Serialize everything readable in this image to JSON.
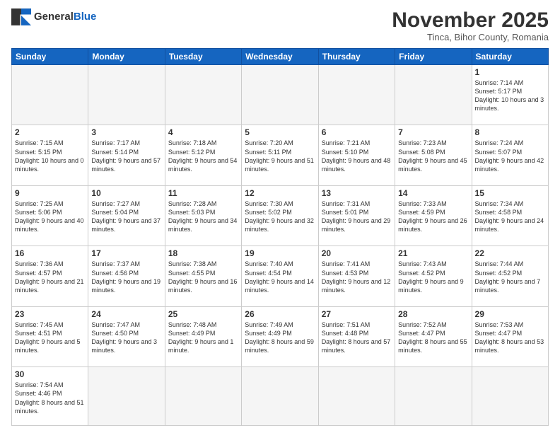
{
  "logo": {
    "general": "General",
    "blue": "Blue"
  },
  "header": {
    "month_title": "November 2025",
    "subtitle": "Tinca, Bihor County, Romania"
  },
  "weekdays": [
    "Sunday",
    "Monday",
    "Tuesday",
    "Wednesday",
    "Thursday",
    "Friday",
    "Saturday"
  ],
  "weeks": [
    [
      {
        "day": "",
        "info": ""
      },
      {
        "day": "",
        "info": ""
      },
      {
        "day": "",
        "info": ""
      },
      {
        "day": "",
        "info": ""
      },
      {
        "day": "",
        "info": ""
      },
      {
        "day": "",
        "info": ""
      },
      {
        "day": "1",
        "info": "Sunrise: 7:14 AM\nSunset: 5:17 PM\nDaylight: 10 hours and 3 minutes."
      }
    ],
    [
      {
        "day": "2",
        "info": "Sunrise: 7:15 AM\nSunset: 5:15 PM\nDaylight: 10 hours and 0 minutes."
      },
      {
        "day": "3",
        "info": "Sunrise: 7:17 AM\nSunset: 5:14 PM\nDaylight: 9 hours and 57 minutes."
      },
      {
        "day": "4",
        "info": "Sunrise: 7:18 AM\nSunset: 5:12 PM\nDaylight: 9 hours and 54 minutes."
      },
      {
        "day": "5",
        "info": "Sunrise: 7:20 AM\nSunset: 5:11 PM\nDaylight: 9 hours and 51 minutes."
      },
      {
        "day": "6",
        "info": "Sunrise: 7:21 AM\nSunset: 5:10 PM\nDaylight: 9 hours and 48 minutes."
      },
      {
        "day": "7",
        "info": "Sunrise: 7:23 AM\nSunset: 5:08 PM\nDaylight: 9 hours and 45 minutes."
      },
      {
        "day": "8",
        "info": "Sunrise: 7:24 AM\nSunset: 5:07 PM\nDaylight: 9 hours and 42 minutes."
      }
    ],
    [
      {
        "day": "9",
        "info": "Sunrise: 7:25 AM\nSunset: 5:06 PM\nDaylight: 9 hours and 40 minutes."
      },
      {
        "day": "10",
        "info": "Sunrise: 7:27 AM\nSunset: 5:04 PM\nDaylight: 9 hours and 37 minutes."
      },
      {
        "day": "11",
        "info": "Sunrise: 7:28 AM\nSunset: 5:03 PM\nDaylight: 9 hours and 34 minutes."
      },
      {
        "day": "12",
        "info": "Sunrise: 7:30 AM\nSunset: 5:02 PM\nDaylight: 9 hours and 32 minutes."
      },
      {
        "day": "13",
        "info": "Sunrise: 7:31 AM\nSunset: 5:01 PM\nDaylight: 9 hours and 29 minutes."
      },
      {
        "day": "14",
        "info": "Sunrise: 7:33 AM\nSunset: 4:59 PM\nDaylight: 9 hours and 26 minutes."
      },
      {
        "day": "15",
        "info": "Sunrise: 7:34 AM\nSunset: 4:58 PM\nDaylight: 9 hours and 24 minutes."
      }
    ],
    [
      {
        "day": "16",
        "info": "Sunrise: 7:36 AM\nSunset: 4:57 PM\nDaylight: 9 hours and 21 minutes."
      },
      {
        "day": "17",
        "info": "Sunrise: 7:37 AM\nSunset: 4:56 PM\nDaylight: 9 hours and 19 minutes."
      },
      {
        "day": "18",
        "info": "Sunrise: 7:38 AM\nSunset: 4:55 PM\nDaylight: 9 hours and 16 minutes."
      },
      {
        "day": "19",
        "info": "Sunrise: 7:40 AM\nSunset: 4:54 PM\nDaylight: 9 hours and 14 minutes."
      },
      {
        "day": "20",
        "info": "Sunrise: 7:41 AM\nSunset: 4:53 PM\nDaylight: 9 hours and 12 minutes."
      },
      {
        "day": "21",
        "info": "Sunrise: 7:43 AM\nSunset: 4:52 PM\nDaylight: 9 hours and 9 minutes."
      },
      {
        "day": "22",
        "info": "Sunrise: 7:44 AM\nSunset: 4:52 PM\nDaylight: 9 hours and 7 minutes."
      }
    ],
    [
      {
        "day": "23",
        "info": "Sunrise: 7:45 AM\nSunset: 4:51 PM\nDaylight: 9 hours and 5 minutes."
      },
      {
        "day": "24",
        "info": "Sunrise: 7:47 AM\nSunset: 4:50 PM\nDaylight: 9 hours and 3 minutes."
      },
      {
        "day": "25",
        "info": "Sunrise: 7:48 AM\nSunset: 4:49 PM\nDaylight: 9 hours and 1 minute."
      },
      {
        "day": "26",
        "info": "Sunrise: 7:49 AM\nSunset: 4:49 PM\nDaylight: 8 hours and 59 minutes."
      },
      {
        "day": "27",
        "info": "Sunrise: 7:51 AM\nSunset: 4:48 PM\nDaylight: 8 hours and 57 minutes."
      },
      {
        "day": "28",
        "info": "Sunrise: 7:52 AM\nSunset: 4:47 PM\nDaylight: 8 hours and 55 minutes."
      },
      {
        "day": "29",
        "info": "Sunrise: 7:53 AM\nSunset: 4:47 PM\nDaylight: 8 hours and 53 minutes."
      }
    ],
    [
      {
        "day": "30",
        "info": "Sunrise: 7:54 AM\nSunset: 4:46 PM\nDaylight: 8 hours and 51 minutes."
      },
      {
        "day": "",
        "info": ""
      },
      {
        "day": "",
        "info": ""
      },
      {
        "day": "",
        "info": ""
      },
      {
        "day": "",
        "info": ""
      },
      {
        "day": "",
        "info": ""
      },
      {
        "day": "",
        "info": ""
      }
    ]
  ]
}
